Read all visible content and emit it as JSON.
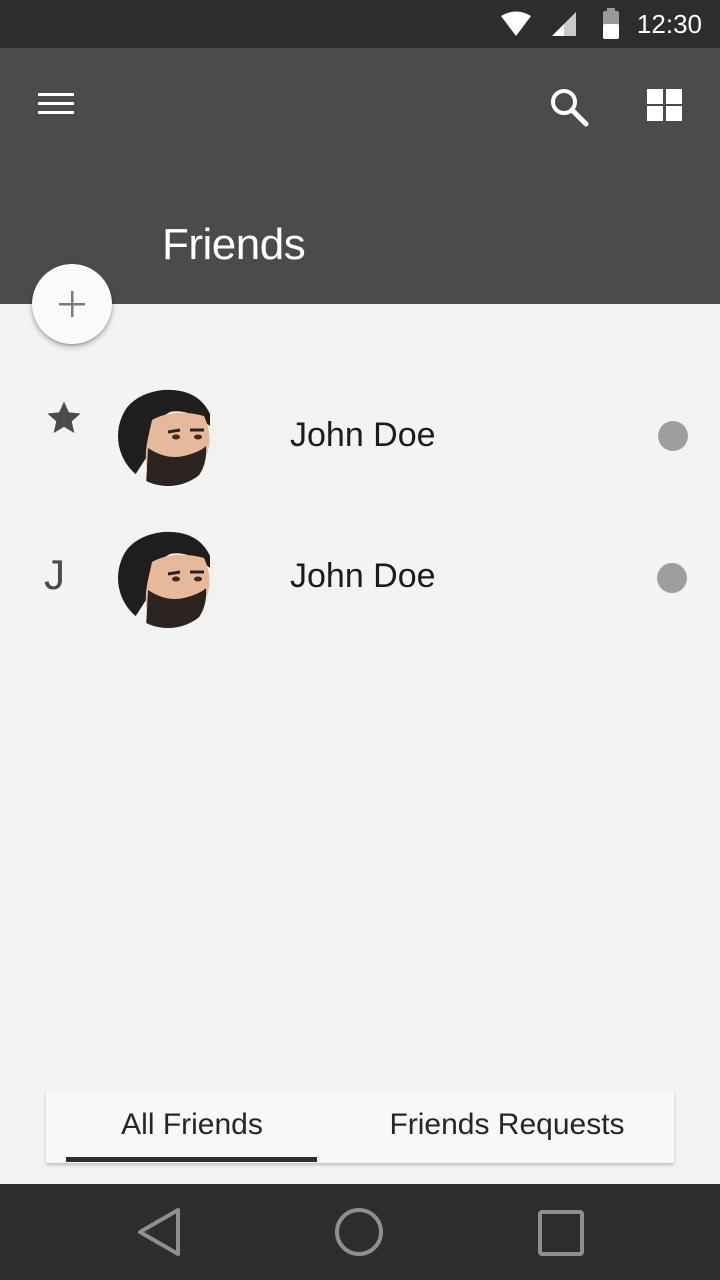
{
  "status_bar": {
    "time": "12:30",
    "icons": [
      "wifi-icon",
      "cell-signal-icon",
      "battery-icon"
    ]
  },
  "app_bar": {
    "title": "Friends",
    "menu_icon": "menu-icon",
    "search_icon": "search-icon",
    "grid_icon": "grid-view-icon",
    "background": "#4b4b4b"
  },
  "fab": {
    "icon": "plus-icon"
  },
  "friends": [
    {
      "marker": "★",
      "marker_icon": "star-icon",
      "name": "John Doe",
      "status_color": "#9e9e9e"
    },
    {
      "marker": "J",
      "name": "John Doe",
      "status_color": "#9e9e9e"
    }
  ],
  "tabs": [
    {
      "label": "All Friends",
      "selected": true
    },
    {
      "label": "Friends Requests",
      "selected": false
    }
  ],
  "nav_bar": {
    "icons": [
      "back-icon",
      "home-icon",
      "recents-icon"
    ]
  }
}
